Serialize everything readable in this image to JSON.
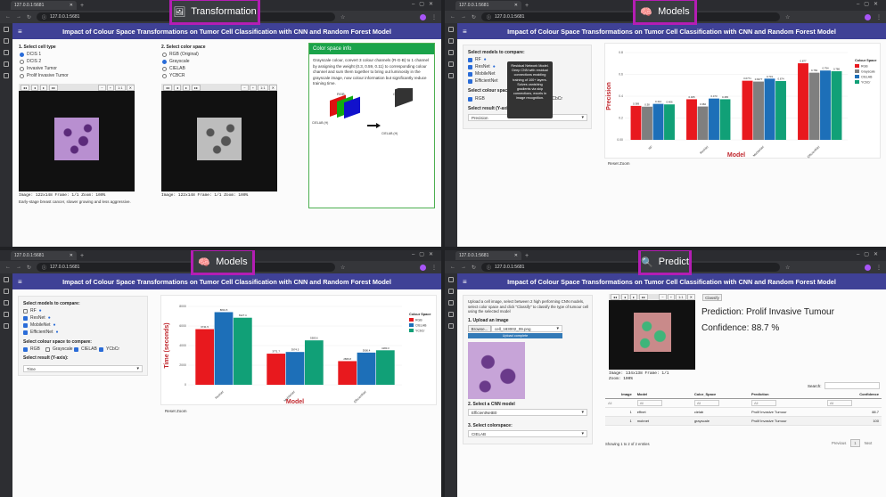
{
  "browser": {
    "tab_title": "127.0.0.1:5681",
    "url": "127.0.0.1:5681"
  },
  "app_title": "Impact of Colour Space Transformations on Tumor Cell Classification with CNN and Random Forest Model",
  "labels": {
    "q1": "Transformation",
    "q2": "Models",
    "q3": "Models",
    "q4": "Predict"
  },
  "transformation": {
    "cell_type_title": "1. Select cell type",
    "cell_types": [
      "DCIS 1",
      "DCIS 2",
      "Invasive Tumor",
      "Prolif Invasive Tumor"
    ],
    "color_space_title": "2. Select color space",
    "color_spaces": [
      "RGB (Original)",
      "Grayscale",
      "CIELAB",
      "YCBCR"
    ],
    "caption_left": "Image: 122x148   Frame: 1/1   Zoom: 100%",
    "caption_right": "Image: 122x148   Frame: 1/1   Zoom: 100%",
    "description": "Early-stage breast cancer, slower growing and less aggressive.",
    "info_title": "Color space info",
    "info_text": "Grayscale colour, convert 3 colour channels (R-G-B) to 1 channel by assigning the weight (0.3, 0.59, 0.11) to corresponding colour channel and sum them together to bring out luminosity in the grayscale image, now colour information but significantly reduce training time.",
    "diagram": {
      "rgb": "RGB",
      "gray": "Grayscale",
      "cielab1": "CIELAB (H)",
      "cielab2": "CIELAB (H)"
    }
  },
  "models_precision": {
    "models_title": "Select models to compare:",
    "models": [
      "RF",
      "ResNet",
      "MobileNet",
      "EfficientNet"
    ],
    "colour_title": "Select colour space to compare:",
    "colour_opts": [
      "RGB",
      "Grayscale",
      "CIELAB",
      "YCbCr"
    ],
    "result_title": "Select result (Y-axis):",
    "result_value": "Precision",
    "tooltip": "Residual Network Model. Deep CNN with residual connections enabling training of 100+ layers. Solves vanishing gradients via skip connections, excels in image recognition.",
    "reset": "Reset Zoom"
  },
  "models_time": {
    "models_title": "Select models to compare:",
    "models": [
      "RF",
      "ResNet",
      "MobileNet",
      "EfficientNet"
    ],
    "colour_title": "Select colour space to compare:",
    "colour_opts": [
      "RGB",
      "Grayscale",
      "CIELAB",
      "YCbCr"
    ],
    "result_title": "Select result (Y-axis):",
    "result_value": "Time",
    "reset": "Reset Zoom"
  },
  "predict": {
    "intro": "Upload a cell image, select between 2 high performing CNN models, select color space and click \"Classify\" to classify the type of tumour cell using the selected model",
    "upload_title": "1. Upload an image",
    "browse": "Browse...",
    "filename": "cell_183002_09.png",
    "upload_status": "Upload complete",
    "cnn_title": "2. Select a CNN model",
    "cnn_value": "EfficientNetB0",
    "cs_title": "3. Select colorspace:",
    "cs_value": "CIELAB",
    "classify": "Classify",
    "prediction": "Prediction: Prolif Invasive Tumour",
    "confidence": "Confidence: 88.7 %",
    "caption": "Image: 134x138   Frame: 1/1",
    "zoom": "Zoom: 100%",
    "search": "Search:",
    "columns": [
      "Image",
      "Model",
      "Color_Space",
      "Prediction",
      "Confidence"
    ],
    "filter_all": "All",
    "rows": [
      {
        "image": "1",
        "model": "effnet",
        "cs": "cielab",
        "pred": "Prolif Invasive Tumour",
        "conf": "88.7"
      },
      {
        "image": "1",
        "model": "mobnet",
        "cs": "grayscale",
        "pred": "Prolif Invasive Tumour",
        "conf": "100"
      }
    ],
    "showing": "Showing 1 to 2 of 2 entries",
    "prev": "Previous",
    "page": "1",
    "next": "Next"
  },
  "chart_data": [
    {
      "type": "bar",
      "categories": [
        "RF",
        "ResNet",
        "MobileNet",
        "EfficientNet"
      ],
      "series": [
        {
          "name": "RGB",
          "color": "#e8191e",
          "values": [
            0.389,
            0.465,
            0.6771,
            0.877
          ]
        },
        {
          "name": "Grayscale",
          "color": "#7f7f7f",
          "values": [
            0.38,
            0.382,
            0.6677,
            0.769
          ]
        },
        {
          "name": "CIELAB",
          "color": "#1d6fb8",
          "values": [
            0.412,
            0.473,
            0.701,
            0.794
          ]
        },
        {
          "name": "YCbCr",
          "color": "#11a077",
          "values": [
            0.406,
            0.465,
            0.674,
            0.786
          ]
        }
      ],
      "labels": [
        [
          "0.389",
          "0.465",
          "0.6771",
          "0.877"
        ],
        [
          "0.38",
          "0.382",
          "0.6677",
          "0.769"
        ],
        [
          "0.412",
          "0.473",
          "0.701",
          "0.794"
        ],
        [
          "0.406",
          "0.465",
          "0.674",
          "0.786"
        ]
      ],
      "ylabel": "Precision",
      "xlabel": "Model",
      "legend_title": "Colour Space",
      "legend": [
        "RGB",
        "Grayscale",
        "CIELAB",
        "YCbCr"
      ],
      "yticks": [
        "0.8",
        "0.6",
        "0.4",
        "0.2",
        "0.00"
      ],
      "ylim": [
        0,
        1
      ]
    },
    {
      "type": "bar",
      "categories": [
        "ResNet",
        "MobileNet",
        "EfficientNet"
      ],
      "series": [
        {
          "name": "RGB",
          "color": "#e8191e",
          "values": [
            6741.5,
            3771.7,
            2866.8
          ]
        },
        {
          "name": "CIELAB",
          "color": "#1d6fb8",
          "values": [
            8801.5,
            3974.5,
            3900.4
          ]
        },
        {
          "name": "YCbCr",
          "color": "#11a077",
          "values": [
            8127.4,
            5383.6,
            4180.3
          ]
        }
      ],
      "labels": [
        [
          "6741.5",
          "3771.7",
          "2866.8"
        ],
        [
          "8801.5",
          "3974.5",
          "3900.4"
        ],
        [
          "8127.4",
          "5383.6",
          "4180.3"
        ]
      ],
      "ylabel": "Time (seconds)",
      "xlabel": "Model",
      "legend_title": "Colour Space",
      "legend": [
        "RGB",
        "CIELAB",
        "YCbCr"
      ],
      "yticks": [
        "8000",
        "6000",
        "4000",
        "2000",
        "0"
      ],
      "ylim": [
        0,
        9500
      ]
    }
  ]
}
